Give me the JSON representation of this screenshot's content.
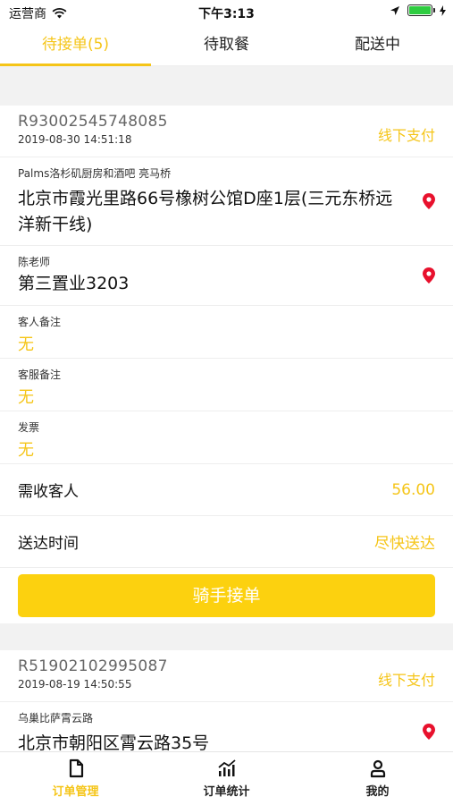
{
  "status_bar": {
    "carrier": "运营商",
    "time": "下午3:13",
    "battery_level": 1.0
  },
  "tabs": [
    {
      "label": "待接单(5)",
      "active": true
    },
    {
      "label": "待取餐",
      "active": false
    },
    {
      "label": "配送中",
      "active": false
    }
  ],
  "orders": [
    {
      "order_no": "R93002545748085",
      "date": "2019-08-30 14:51:18",
      "payment": "线下支付",
      "pickup_label": "Palms洛杉矶厨房和酒吧 亮马桥",
      "pickup_address": "北京市霞光里路66号橡树公馆D座1层(三元东桥远洋新干线)",
      "customer_label": "陈老师",
      "customer_address": "第三置业3203",
      "guest_note_label": "客人备注",
      "guest_note_value": "无",
      "service_note_label": "客服备注",
      "service_note_value": "无",
      "invoice_label": "发票",
      "invoice_value": "无",
      "collect_label": "需收客人",
      "collect_value": "56.00",
      "delivery_time_label": "送达时间",
      "delivery_time_value": "尽快送达",
      "accept_button": "骑手接单"
    },
    {
      "order_no": "R51902102995087",
      "date": "2019-08-19 14:50:55",
      "payment": "线下支付",
      "pickup_label": "乌巢比萨霄云路",
      "pickup_address": "北京市朝阳区霄云路35号"
    }
  ],
  "bottom_nav": [
    {
      "label": "订单管理",
      "icon": "document-icon",
      "active": true
    },
    {
      "label": "订单统计",
      "icon": "bar-chart-icon",
      "active": false
    },
    {
      "label": "我的",
      "icon": "user-icon",
      "active": false
    }
  ],
  "colors": {
    "accent": "#f5c518",
    "button": "#fcd10f",
    "pin": "#e8112d",
    "background": "#f2f2f2"
  }
}
